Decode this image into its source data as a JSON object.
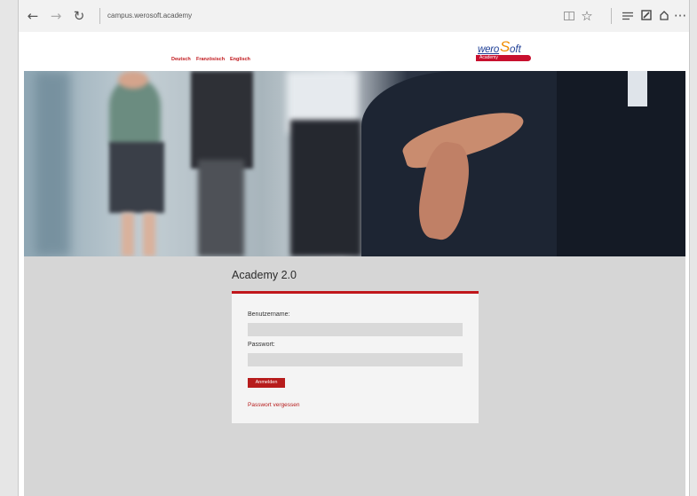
{
  "browser": {
    "url": "campus.werosoft.academy",
    "icons": [
      "back-icon",
      "forward-icon",
      "refresh-icon",
      "reading-view-icon",
      "favorite-star-icon",
      "hub-icon",
      "web-note-icon",
      "share-icon",
      "more-icon"
    ]
  },
  "header": {
    "languages": [
      "Deutsch",
      "Französisch",
      "Englisch"
    ],
    "logo": {
      "word": "wero",
      "s": "S",
      "oft": "oft",
      "sub": "Academy"
    }
  },
  "colors": {
    "accent": "#c0161b",
    "logo_blue": "#1f3f96",
    "logo_orange": "#f08c00",
    "page_bg": "#d6d6d6",
    "card_bg": "#f4f4f4"
  },
  "main": {
    "title": "Academy 2.0",
    "form": {
      "username_label": "Benutzername:",
      "username_value": "",
      "password_label": "Passwort:",
      "password_value": "",
      "login_button": "Anmelden",
      "forgot_link": "Passwort vergessen"
    }
  }
}
